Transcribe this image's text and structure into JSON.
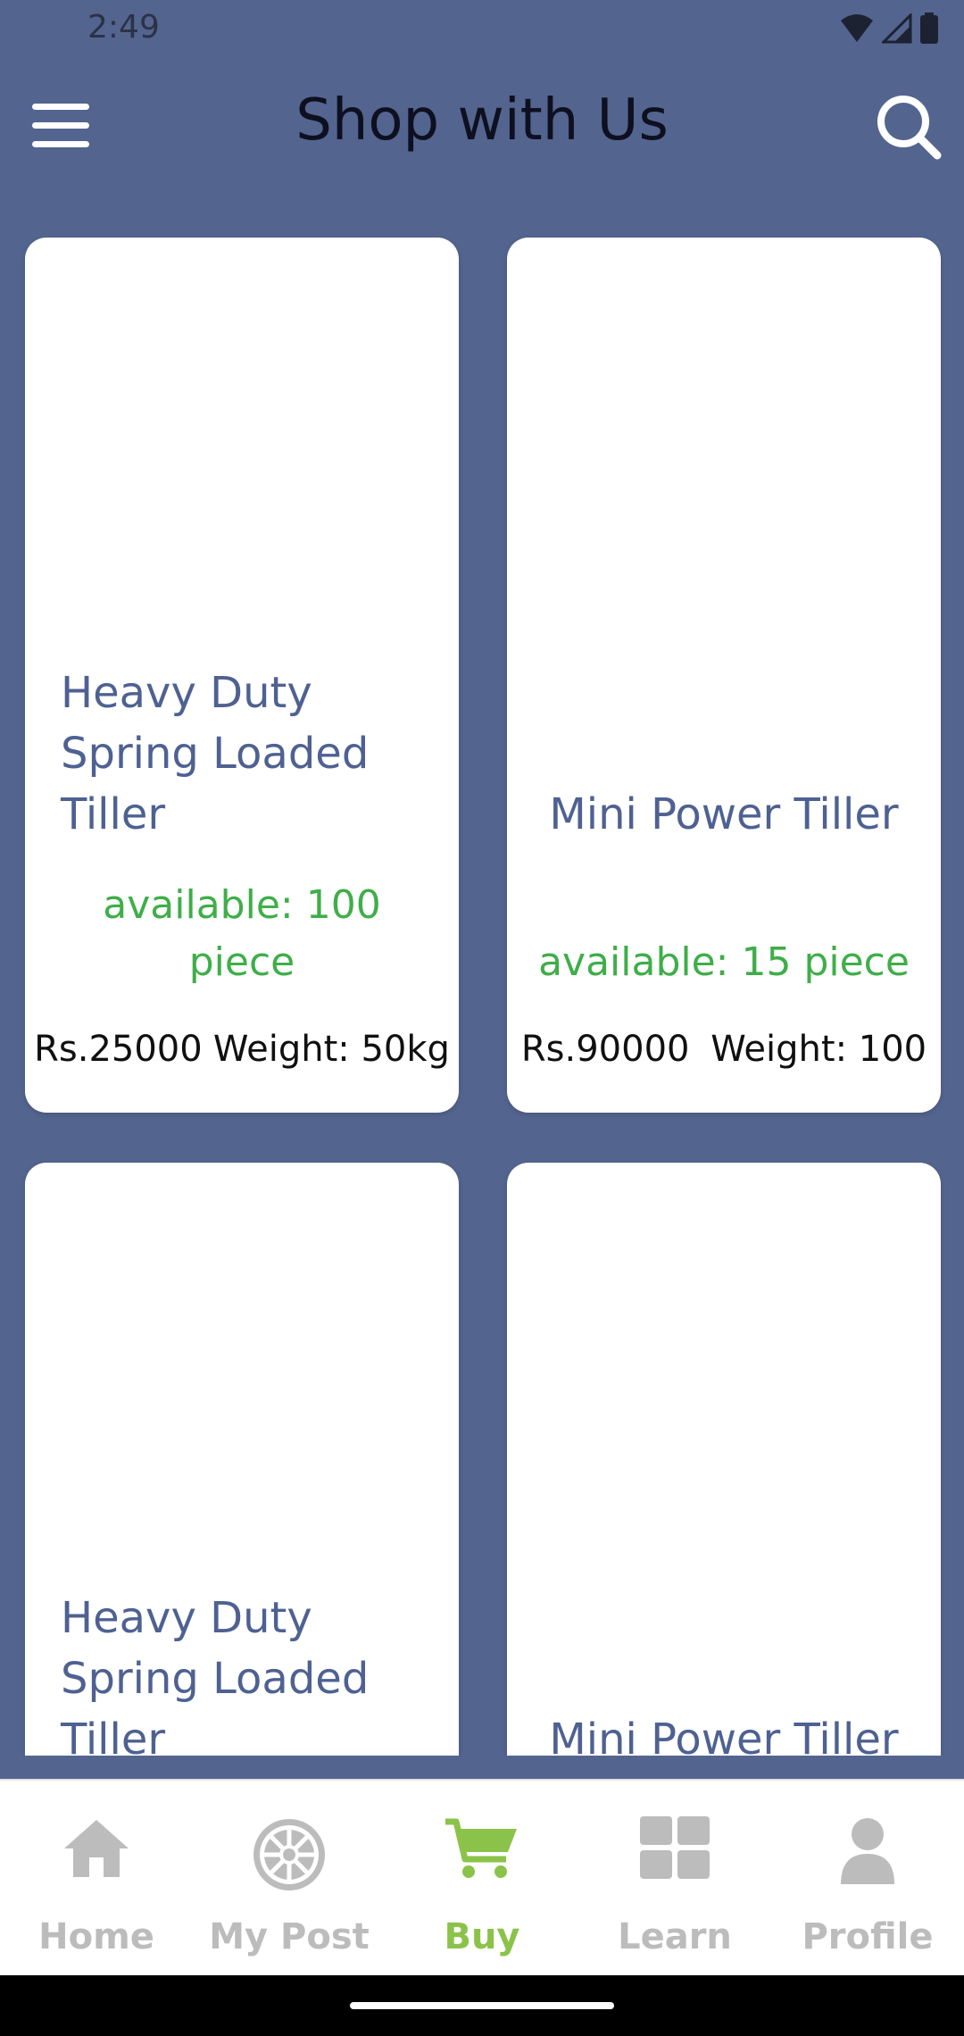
{
  "status": {
    "time": "2:49"
  },
  "header": {
    "title": "Shop with Us"
  },
  "products": [
    {
      "name": "Heavy Duty Spring Loaded Tiller",
      "availability": "available: 100 piece",
      "price": "Rs.25000",
      "weight": "Weight: 50kg"
    },
    {
      "name": "Mini Power Tiller",
      "availability": "available: 15 piece",
      "price": "Rs.90000",
      "weight": "Weight: 100"
    },
    {
      "name": "Heavy Duty Spring Loaded Tiller"
    },
    {
      "name": "Mini Power Tiller"
    }
  ],
  "nav": {
    "items": [
      {
        "label": "Home",
        "icon": "home-icon"
      },
      {
        "label": "My Post",
        "icon": "emblem-icon"
      },
      {
        "label": "Buy",
        "icon": "cart-icon",
        "active": true
      },
      {
        "label": "Learn",
        "icon": "grid-icon"
      },
      {
        "label": "Profile",
        "icon": "person-icon"
      }
    ]
  },
  "colors": {
    "background": "#53648f",
    "accent": "#8bc34a",
    "product_name": "#4e6192",
    "availability": "#3fae49"
  }
}
